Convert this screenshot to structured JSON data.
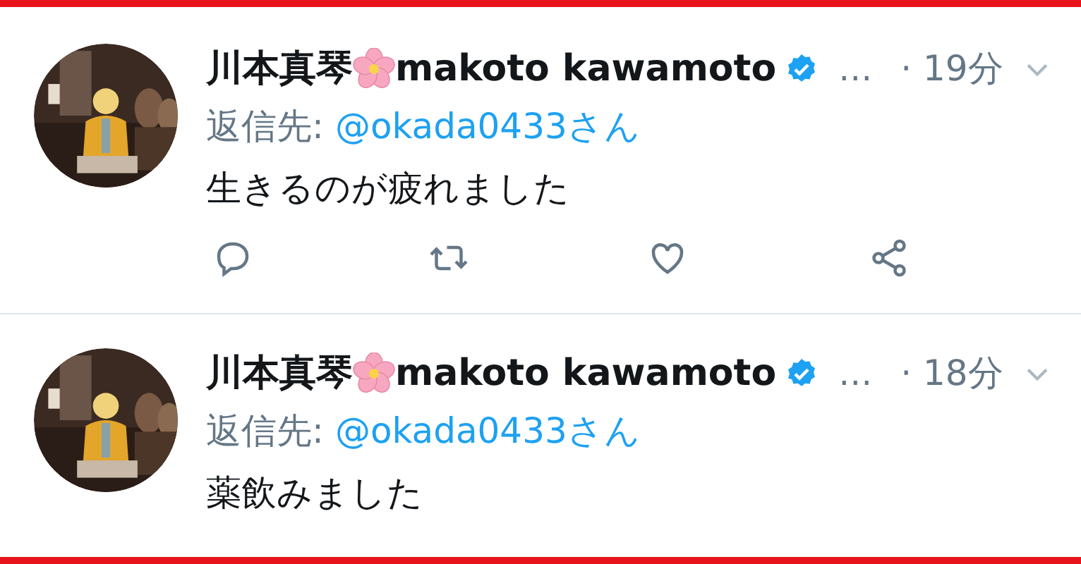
{
  "tweets": [
    {
      "name": "川本真琴",
      "name_latin": "makoto kawamoto",
      "verified": true,
      "ellipsis": "…",
      "time": "· 19分",
      "reply_label": "返信先:",
      "reply_to": "@okada0433さん",
      "text": "生きるのが疲れました",
      "actions_visible": true
    },
    {
      "name": "川本真琴",
      "name_latin": "makoto kawamoto",
      "verified": true,
      "ellipsis": "…",
      "time": "· 18分",
      "reply_label": "返信先:",
      "reply_to": "@okada0433さん",
      "text": "薬飲みました",
      "actions_visible": false
    }
  ]
}
